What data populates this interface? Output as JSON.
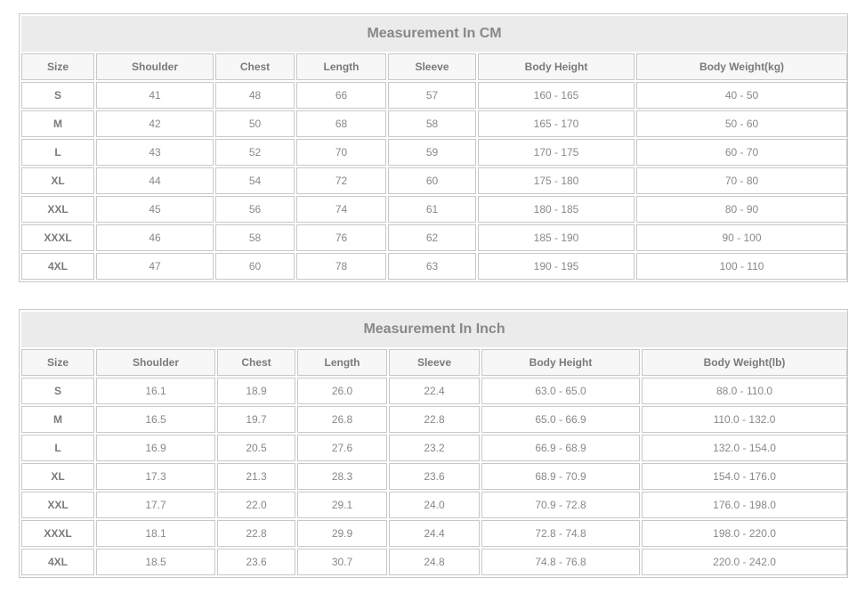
{
  "tables": [
    {
      "title": "Measurement In CM",
      "headers": [
        "Size",
        "Shoulder",
        "Chest",
        "Length",
        "Sleeve",
        "Body Height",
        "Body Weight(kg)"
      ],
      "rows": [
        [
          "S",
          "41",
          "48",
          "66",
          "57",
          "160 - 165",
          "40 - 50"
        ],
        [
          "M",
          "42",
          "50",
          "68",
          "58",
          "165 - 170",
          "50 - 60"
        ],
        [
          "L",
          "43",
          "52",
          "70",
          "59",
          "170 - 175",
          "60 - 70"
        ],
        [
          "XL",
          "44",
          "54",
          "72",
          "60",
          "175 - 180",
          "70 - 80"
        ],
        [
          "XXL",
          "45",
          "56",
          "74",
          "61",
          "180 - 185",
          "80 - 90"
        ],
        [
          "XXXL",
          "46",
          "58",
          "76",
          "62",
          "185 - 190",
          "90 - 100"
        ],
        [
          "4XL",
          "47",
          "60",
          "78",
          "63",
          "190 - 195",
          "100 - 110"
        ]
      ]
    },
    {
      "title": "Measurement In Inch",
      "headers": [
        "Size",
        "Shoulder",
        "Chest",
        "Length",
        "Sleeve",
        "Body Height",
        "Body Weight(lb)"
      ],
      "rows": [
        [
          "S",
          "16.1",
          "18.9",
          "26.0",
          "22.4",
          "63.0 - 65.0",
          "88.0 - 110.0"
        ],
        [
          "M",
          "16.5",
          "19.7",
          "26.8",
          "22.8",
          "65.0 - 66.9",
          "110.0 - 132.0"
        ],
        [
          "L",
          "16.9",
          "20.5",
          "27.6",
          "23.2",
          "66.9 - 68.9",
          "132.0 - 154.0"
        ],
        [
          "XL",
          "17.3",
          "21.3",
          "28.3",
          "23.6",
          "68.9 - 70.9",
          "154.0 - 176.0"
        ],
        [
          "XXL",
          "17.7",
          "22.0",
          "29.1",
          "24.0",
          "70.9 - 72.8",
          "176.0 - 198.0"
        ],
        [
          "XXXL",
          "18.1",
          "22.8",
          "29.9",
          "24.4",
          "72.8 - 74.8",
          "198.0 - 220.0"
        ],
        [
          "4XL",
          "18.5",
          "23.6",
          "30.7",
          "24.8",
          "74.8 - 76.8",
          "220.0 - 242.0"
        ]
      ]
    }
  ]
}
